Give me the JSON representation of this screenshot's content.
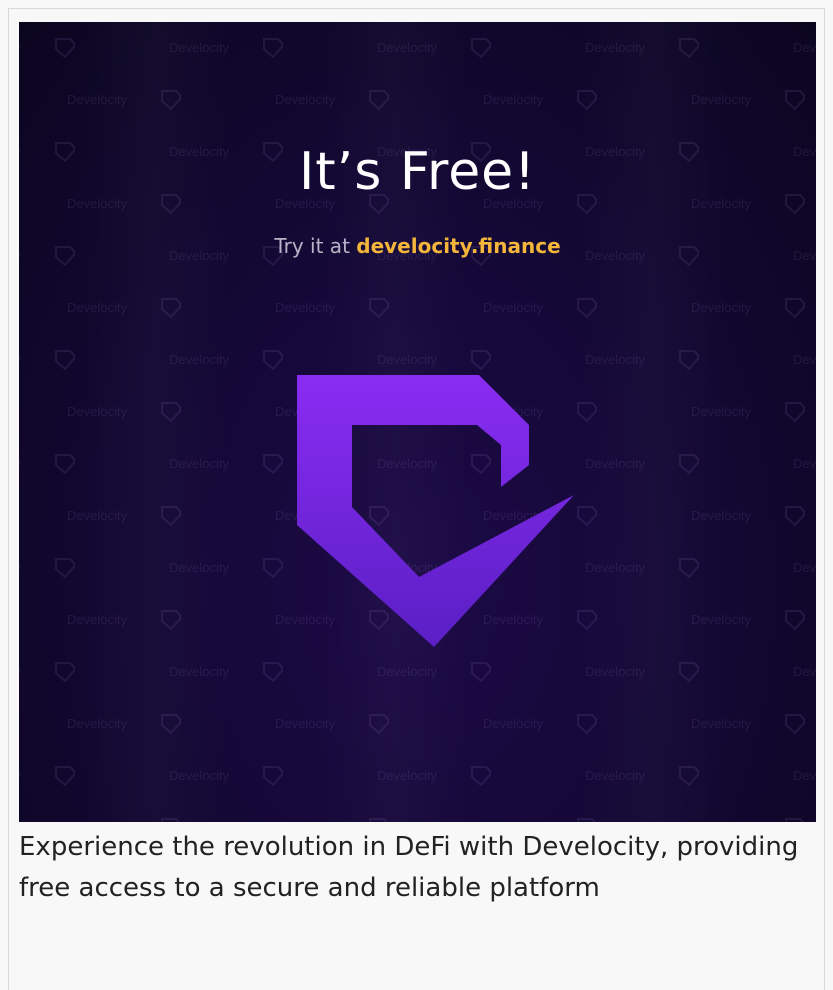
{
  "banner": {
    "headline": "It’s Free!",
    "tagline_prefix": "Try it at",
    "tagline_link": "develocity.finance",
    "watermark_text": "Develocity",
    "logo_icon": "develocity-shield-logo-icon",
    "colors": {
      "headline": "#ffffff",
      "link": "#f3b63b",
      "logo_top": "#8a2cf2",
      "logo_bottom": "#5a1fc4",
      "background": "#140836"
    }
  },
  "caption": {
    "text": "Experience the revolution in DeFi with Develocity, providing free access to a secure and reliable platform"
  }
}
